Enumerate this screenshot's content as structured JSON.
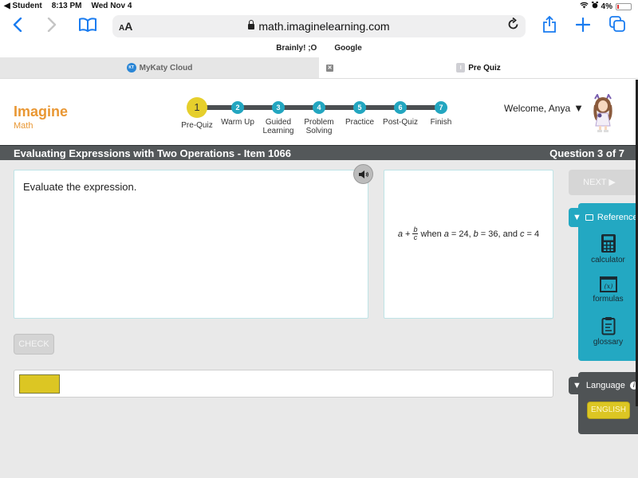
{
  "status_bar": {
    "back_app": "◀ Student",
    "time": "8:13 PM",
    "date": "Wed Nov 4",
    "battery": "4%"
  },
  "browser": {
    "text_size_label": "AA",
    "url": "math.imaginelearning.com",
    "favorites": [
      "Brainly! ;O",
      "Google"
    ],
    "tabs": [
      {
        "title": "MyKaty Cloud",
        "active": false
      },
      {
        "title": "Pre Quiz",
        "active": true
      }
    ]
  },
  "app": {
    "brand": {
      "title": "Imagine",
      "subtitle": "Math"
    },
    "progress_steps": [
      {
        "number": "1",
        "label": "Pre-Quiz",
        "current": true
      },
      {
        "number": "2",
        "label": "Warm Up",
        "current": false
      },
      {
        "number": "3",
        "label": "Guided Learning",
        "current": false
      },
      {
        "number": "4",
        "label": "Problem Solving",
        "current": false
      },
      {
        "number": "5",
        "label": "Practice",
        "current": false
      },
      {
        "number": "6",
        "label": "Post-Quiz",
        "current": false
      },
      {
        "number": "7",
        "label": "Finish",
        "current": false
      }
    ],
    "welcome": "Welcome, Anya",
    "lesson_title": "Evaluating Expressions with Two Operations - Item 1066",
    "question_counter": "Question 3 of 7"
  },
  "question": {
    "prompt": "Evaluate the expression.",
    "expression": {
      "var_a": "a",
      "plus": "+",
      "numerator": "b",
      "denominator": "c",
      "condition_when": "when",
      "a_label": "a",
      "a_value": "= 24,",
      "b_label": "b",
      "b_value": "= 36, and",
      "c_label": "c",
      "c_value": "= 4"
    },
    "answer_value": ""
  },
  "buttons": {
    "check": "CHECK",
    "next": "NEXT ▶"
  },
  "reference": {
    "title": "Reference",
    "items": [
      "calculator",
      "formulas",
      "glossary"
    ]
  },
  "language": {
    "title": "Language",
    "selected": "ENGLISH"
  },
  "colors": {
    "brand_orange": "#e99733",
    "teal_accent": "#23a8c2",
    "current_step_yellow": "#e6cf2c",
    "title_bar": "#54585a",
    "answer_chip": "#dcc623"
  }
}
